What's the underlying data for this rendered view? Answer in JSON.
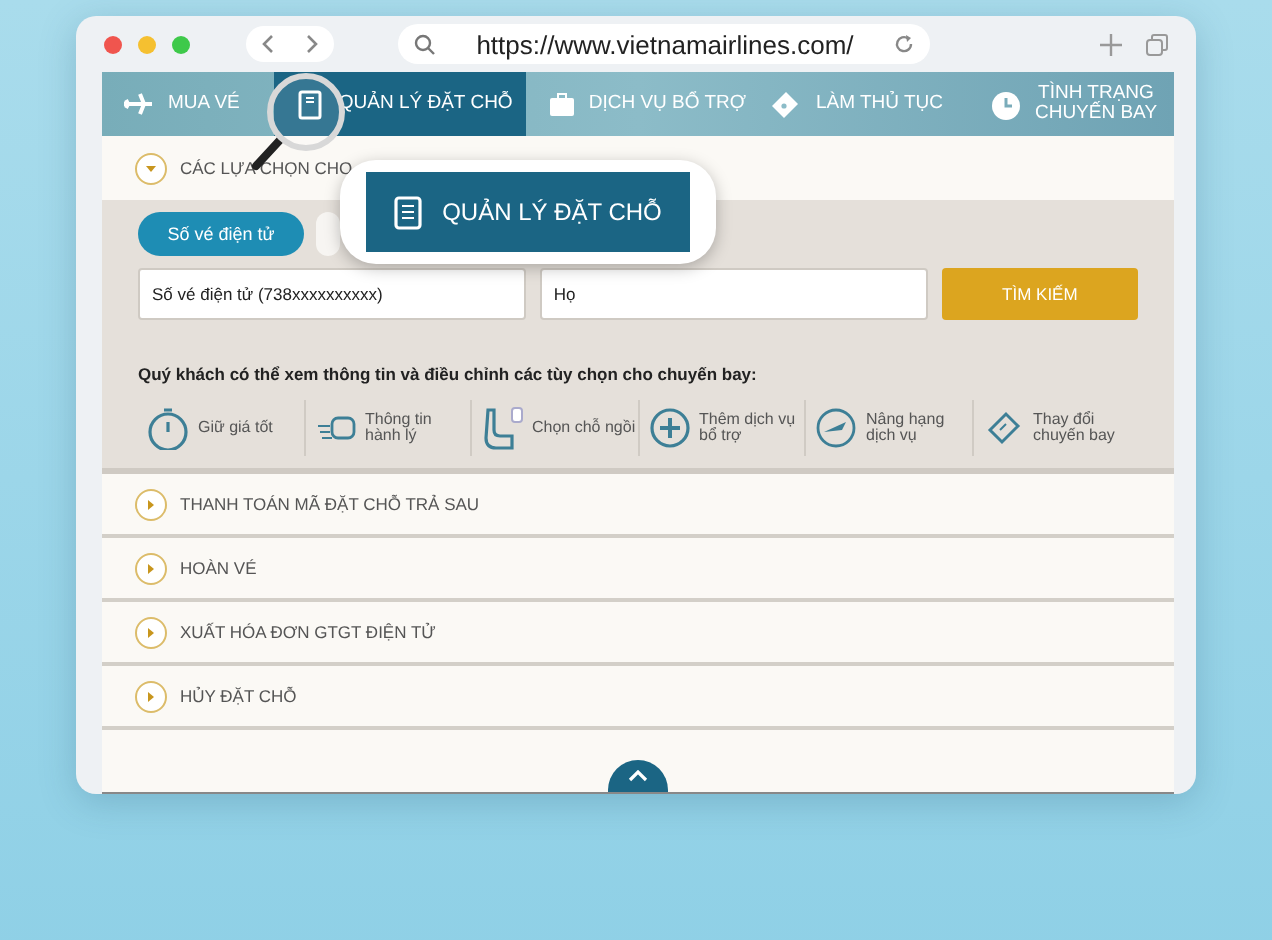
{
  "browser": {
    "url": "https://www.vietnamairlines.com/"
  },
  "nav_tabs": [
    {
      "label": "MUA VÉ",
      "kind": "plane",
      "selected": false
    },
    {
      "label": "QUẢN LÝ ĐẶT CHỖ",
      "kind": "book",
      "selected": true
    },
    {
      "label": "DỊCH VỤ BỔ TRỢ",
      "kind": "bag",
      "selected": false
    },
    {
      "label": "LÀM THỦ TỤC",
      "kind": "ticket",
      "selected": false
    },
    {
      "label": "TÌNH TRẠNG CHUYẾN BAY",
      "kind": "clock",
      "selected": false
    }
  ],
  "open_section": {
    "label": "CÁC LỰA CHỌN CHO",
    "expanded": true
  },
  "search_tabs": [
    {
      "label": "Số vé điện tử",
      "selected": true
    },
    {
      "selected": false
    }
  ],
  "fields": [
    {
      "value": "Số vé điện tử (738xxxxxxxxxx)"
    },
    {
      "value": "Họ"
    }
  ],
  "search_button": "TÌM KIẾM",
  "info_text": "Quý khách có thể xem thông tin và điều chỉnh các tùy chọn cho chuyến bay:",
  "options": [
    {
      "label": "Giữ giá tốt",
      "kind": "stopwatch"
    },
    {
      "label": "Thông tin hành lý",
      "kind": "luggage"
    },
    {
      "label": "Chọn chỗ ngồi",
      "kind": "seat"
    },
    {
      "label": "Thêm dịch vụ bổ trợ",
      "kind": "plus"
    },
    {
      "label": "Nâng hạng dịch vụ",
      "kind": "upgrade"
    },
    {
      "label": "Thay đổi chuyến bay",
      "kind": "change"
    }
  ],
  "sections": [
    {
      "label": "THANH TOÁN MÃ ĐẶT CHỖ TRẢ SAU",
      "expanded": false
    },
    {
      "label": "HOÀN VÉ",
      "expanded": false
    },
    {
      "label": "XUẤT HÓA ĐƠN GTGT ĐIỆN TỬ",
      "expanded": false
    },
    {
      "label": "HỦY ĐẶT CHỖ",
      "expanded": false
    }
  ],
  "callout": {
    "label": "QUẢN LÝ ĐẶT CHỖ"
  }
}
